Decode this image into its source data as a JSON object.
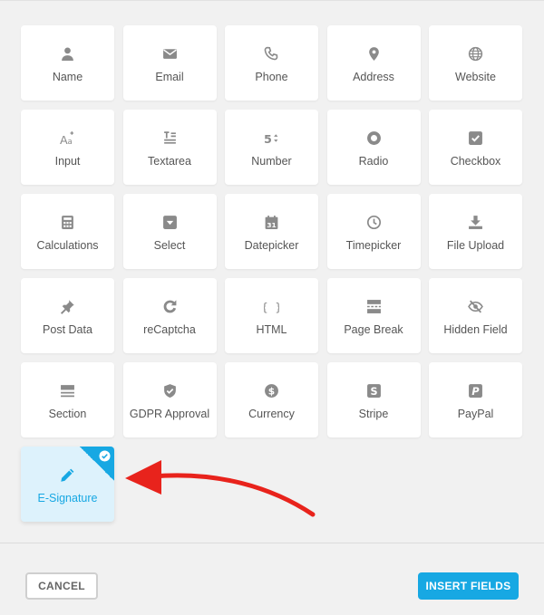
{
  "fields": [
    {
      "label": "Name",
      "icon": "user-icon"
    },
    {
      "label": "Email",
      "icon": "envelope-icon"
    },
    {
      "label": "Phone",
      "icon": "phone-icon"
    },
    {
      "label": "Address",
      "icon": "map-pin-icon"
    },
    {
      "label": "Website",
      "icon": "globe-icon"
    },
    {
      "label": "Input",
      "icon": "text-format-icon"
    },
    {
      "label": "Textarea",
      "icon": "textarea-icon"
    },
    {
      "label": "Number",
      "icon": "number-icon"
    },
    {
      "label": "Radio",
      "icon": "radio-icon"
    },
    {
      "label": "Checkbox",
      "icon": "checkbox-icon"
    },
    {
      "label": "Calculations",
      "icon": "calculator-icon"
    },
    {
      "label": "Select",
      "icon": "dropdown-icon"
    },
    {
      "label": "Datepicker",
      "icon": "calendar-icon"
    },
    {
      "label": "Timepicker",
      "icon": "clock-icon"
    },
    {
      "label": "File Upload",
      "icon": "upload-icon"
    },
    {
      "label": "Post Data",
      "icon": "pin-icon"
    },
    {
      "label": "reCaptcha",
      "icon": "recaptcha-icon"
    },
    {
      "label": "HTML",
      "icon": "braces-icon"
    },
    {
      "label": "Page Break",
      "icon": "page-break-icon"
    },
    {
      "label": "Hidden Field",
      "icon": "eye-off-icon"
    },
    {
      "label": "Section",
      "icon": "section-icon"
    },
    {
      "label": "GDPR Approval",
      "icon": "shield-check-icon"
    },
    {
      "label": "Currency",
      "icon": "dollar-icon"
    },
    {
      "label": "Stripe",
      "icon": "stripe-icon"
    },
    {
      "label": "PayPal",
      "icon": "paypal-icon"
    },
    {
      "label": "E-Signature",
      "icon": "pencil-icon",
      "selected": true
    }
  ],
  "footer": {
    "cancel_label": "CANCEL",
    "insert_label": "INSERT FIELDS"
  },
  "colors": {
    "accent": "#17a8e3",
    "selected_bg": "#ddf2fc",
    "icon": "#8a8a8a",
    "annotation_arrow": "#e8231c"
  }
}
